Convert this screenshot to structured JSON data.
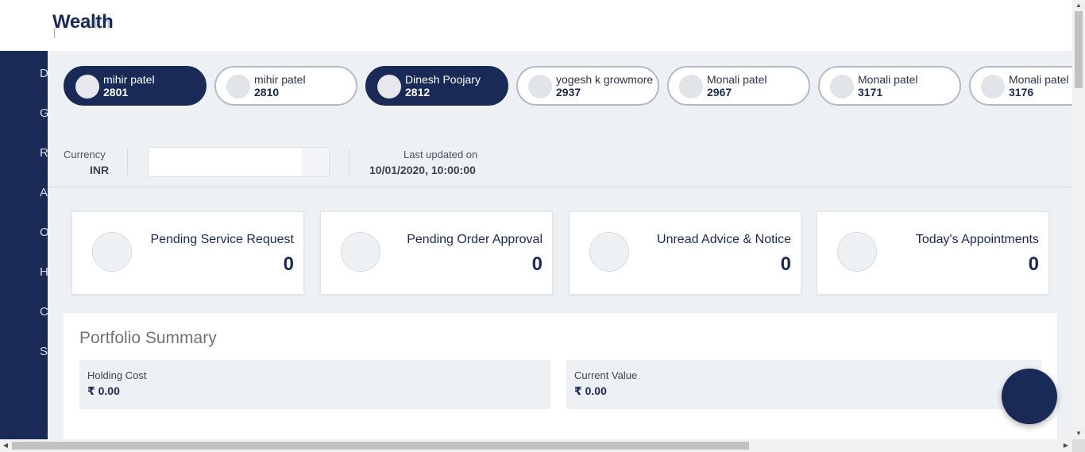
{
  "header": {
    "logo_text": "Wealth",
    "logo_overlay_text": "elth"
  },
  "sidebar": {
    "items": [
      "D",
      "G",
      "R",
      "A",
      "O",
      "H",
      "C",
      "S"
    ]
  },
  "clients": [
    {
      "name": "mihir patel",
      "code": "2801",
      "active": true
    },
    {
      "name": "mihir patel",
      "code": "2810",
      "active": false
    },
    {
      "name": "Dinesh Poojary",
      "code": "2812",
      "active": true
    },
    {
      "name": "yogesh k growmore",
      "code": "2937",
      "active": false
    },
    {
      "name": "Monali patel",
      "code": "2967",
      "active": false
    },
    {
      "name": "Monali patel",
      "code": "3171",
      "active": false
    },
    {
      "name": "Monali patel",
      "code": "3176",
      "active": false
    }
  ],
  "info": {
    "currency_label": "Currency",
    "currency_value": "INR",
    "currency_select_value": "",
    "updated_label": "Last updated on",
    "updated_value": "10/01/2020, 10:00:00"
  },
  "stats": [
    {
      "title": "Pending Service Request",
      "value": "0"
    },
    {
      "title": "Pending Order Approval",
      "value": "0"
    },
    {
      "title": "Unread Advice & Notice",
      "value": "0"
    },
    {
      "title": "Today's Appointments",
      "value": "0"
    }
  ],
  "portfolio": {
    "title": "Portfolio Summary",
    "holding_cost_label": "Holding Cost",
    "holding_cost_value": "₹ 0.00",
    "current_value_label": "Current Value",
    "current_value_value": "₹ 0.00"
  },
  "scrollbars": {
    "up_arrow": "▲",
    "down_arrow": "▼",
    "left_arrow": "◀",
    "right_arrow": "▶"
  },
  "colors": {
    "primary": "#182a55",
    "background": "#eef1f4",
    "card": "#ffffff"
  }
}
